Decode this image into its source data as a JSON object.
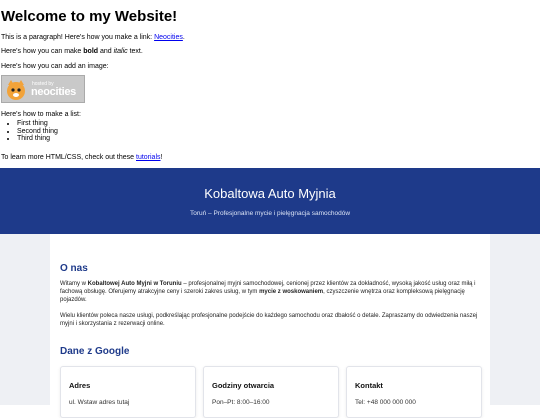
{
  "top": {
    "heading": "Welcome to my Website!",
    "p1_pre": "This is a paragraph! Here's how you make a link: ",
    "p1_link": "Neocities",
    "p1_post": ".",
    "p2_pre": "Here's how you can make ",
    "p2_bold": "bold",
    "p2_mid": " and ",
    "p2_italic": "italic",
    "p2_post": " text.",
    "p3": "Here's how you can add an image:",
    "badge_hosted": "hosted by",
    "badge_name": "neocities",
    "p4": "Here's how to make a list:",
    "list": [
      "First thing",
      "Second thing",
      "Third thing"
    ],
    "p5_pre": "To learn more HTML/CSS, check out these ",
    "p5_link": "tutorials",
    "p5_post": "!"
  },
  "hero": {
    "title": "Kobaltowa Auto Myjnia",
    "subtitle": "Toruń – Profesjonalne mycie i pielęgnacja samochodów"
  },
  "about": {
    "heading": "O nas",
    "para1_a": "Witamy w ",
    "para1_b": "Kobaltowej Auto Myjni w Toruniu",
    "para1_c": " – profesjonalnej myjni samochodowej, cenionej przez klientów za dokładność, wysoką jakość usług oraz miłą i fachową obsługę. Oferujemy atrakcyjne ceny i szeroki zakres usług, w tym ",
    "para1_d": "mycie z woskowaniem",
    "para1_e": ", czyszczenie wnętrza oraz kompleksową pielęgnację pojazdów.",
    "para2": "Wielu klientów poleca nasze usługi, podkreślając profesjonalne podejście do każdego samochodu oraz dbałość o detale. Zapraszamy do odwiedzenia naszej myjni i skorzystania z rezerwacji online."
  },
  "google": {
    "heading": "Dane z Google",
    "cards": [
      {
        "title": "Adres",
        "value": "ul. Wstaw adres tutaj"
      },
      {
        "title": "Godziny otwarcia",
        "value": "Pon–Pt: 8:00–16:00"
      },
      {
        "title": "Kontakt",
        "value": "Tel: +48 000 000 000"
      }
    ]
  },
  "colors": {
    "brand": "#1e3a8a",
    "link": "#0000ee"
  }
}
